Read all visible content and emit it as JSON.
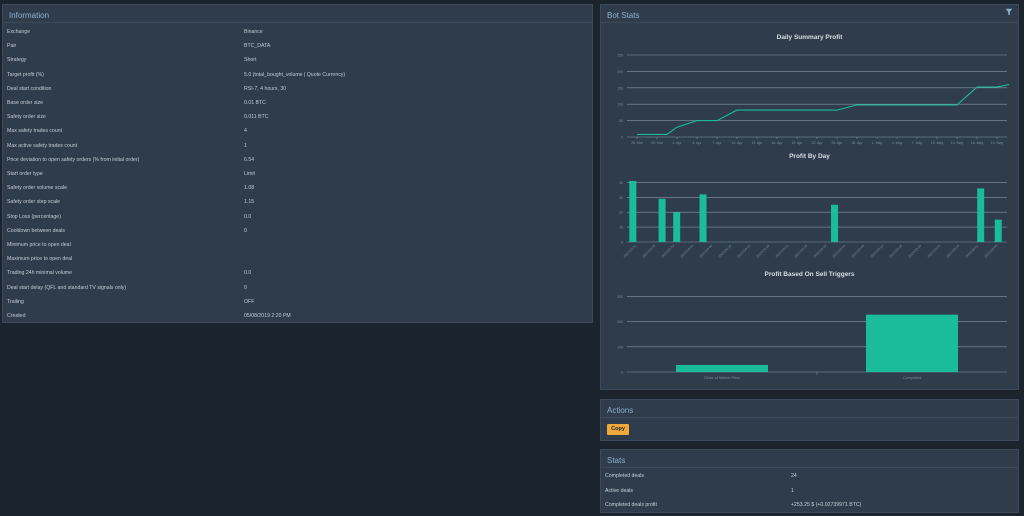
{
  "info": {
    "title": "Information",
    "rows": [
      {
        "key": "Exchange",
        "value": "Binance"
      },
      {
        "key": "Pair",
        "value": "BTC_DATA"
      },
      {
        "key": "Strategy",
        "value": "Short"
      },
      {
        "key": "Target profit (%)",
        "value": "5.0 (total_bought_volume | Quote Currency)"
      },
      {
        "key": "Deal start condition",
        "value": "RSI-7, 4 hours, 30"
      },
      {
        "key": "Base order size",
        "value": "0.01 BTC"
      },
      {
        "key": "Safety order size",
        "value": "0.011 BTC"
      },
      {
        "key": "Max safety trades count",
        "value": "4"
      },
      {
        "key": "Max active safety trades count",
        "value": "1"
      },
      {
        "key": "Price deviation to open safety orders (% from initial order)",
        "value": "6.54"
      },
      {
        "key": "Start order type",
        "value": "Limit"
      },
      {
        "key": "Safety order volume scale",
        "value": "1.08"
      },
      {
        "key": "Safety order step scale",
        "value": "1.15"
      },
      {
        "key": "Stop Loss (percentage)",
        "value": "0.0"
      },
      {
        "key": "Cooldown between deals",
        "value": "0"
      },
      {
        "key": "Minimum price to open deal",
        "value": ""
      },
      {
        "key": "Maximum price to open deal",
        "value": ""
      },
      {
        "key": "Trading 24h minimal volume",
        "value": "0.0"
      },
      {
        "key": "Deal start delay (QFL and standard TV signals only)",
        "value": "0"
      },
      {
        "key": "Trailing",
        "value": "OFF"
      },
      {
        "key": "Created",
        "value": "05/08/2019 2:20 PM"
      }
    ]
  },
  "bot_stats": {
    "title": "Bot Stats",
    "filter_icon": "filter-icon"
  },
  "chart_data": [
    {
      "type": "line",
      "title": "Daily Summary Profit",
      "x": [
        "26. Mar",
        "29. Mar",
        "1. Apr",
        "4. Apr",
        "7. Apr",
        "10. Apr",
        "13. Apr",
        "16. Apr",
        "19. Apr",
        "22. Apr",
        "25. Apr",
        "28. Apr",
        "1. May",
        "4. May",
        "7. May",
        "10. May",
        "13. May",
        "16. May",
        "19. May"
      ],
      "yticks": [
        "0",
        "50",
        "100",
        "150",
        "200",
        "250"
      ],
      "ylim": [
        0,
        250
      ],
      "series": [
        {
          "color": "#1abc9c",
          "points": [
            [
              0,
              8
            ],
            [
              1.5,
              8
            ],
            [
              2,
              30
            ],
            [
              3,
              50
            ],
            [
              4,
              50
            ],
            [
              5,
              82
            ],
            [
              6,
              82
            ],
            [
              10,
              82
            ],
            [
              11,
              98
            ],
            [
              12,
              98
            ],
            [
              15,
              98
            ],
            [
              16,
              98
            ],
            [
              17,
              152
            ],
            [
              18,
              152
            ],
            [
              18.6,
              160
            ]
          ]
        }
      ]
    },
    {
      "type": "bar",
      "title": "Profit By Day",
      "categories": [
        "2019-03-21",
        "2019-03-25",
        "2019-03-29",
        "2019-04-02",
        "2019-04-06",
        "2019-04-10",
        "2019-04-14",
        "2019-04-18",
        "2019-04-22",
        "2019-04-26",
        "2019-04-30",
        "2019-05-04",
        "2019-05-08",
        "2019-05-12",
        "2019-05-16",
        "2019-05-20",
        "2019-05-24",
        "2019-05-28",
        "2019-06-01",
        "2019-06-05"
      ],
      "yticks": [
        "0",
        "10",
        "20",
        "30",
        "40"
      ],
      "ylim": [
        0,
        45
      ],
      "bars": [
        {
          "x": 0.4,
          "value": 41
        },
        {
          "x": 2.4,
          "value": 29
        },
        {
          "x": 3.4,
          "value": 20
        },
        {
          "x": 5.2,
          "value": 32
        },
        {
          "x": 14.2,
          "value": 25
        },
        {
          "x": 24.2,
          "value": 36
        },
        {
          "x": 25.4,
          "value": 15
        }
      ],
      "xmax": 26
    },
    {
      "type": "bar",
      "title": "Profit Based On Sell Triggers",
      "categories": [
        "Close at Market Price",
        "Completed"
      ],
      "yticks": [
        "0",
        "100",
        "200",
        "300"
      ],
      "ylim": [
        0,
        330
      ],
      "values": [
        28,
        228
      ]
    }
  ],
  "actions": {
    "title": "Actions",
    "copy_label": "Copy"
  },
  "stats": {
    "title": "Stats",
    "rows": [
      {
        "key": "Completed deals",
        "value": "24"
      },
      {
        "key": "Active deals",
        "value": "1"
      },
      {
        "key": "Completed deals profit",
        "value": "+253.25 $ (+0.02739971 BTC)"
      }
    ]
  },
  "colors": {
    "accent": "#1abc9c",
    "button": "#f0a83a",
    "panel": "#2e3c4b",
    "background": "#1b232d"
  }
}
